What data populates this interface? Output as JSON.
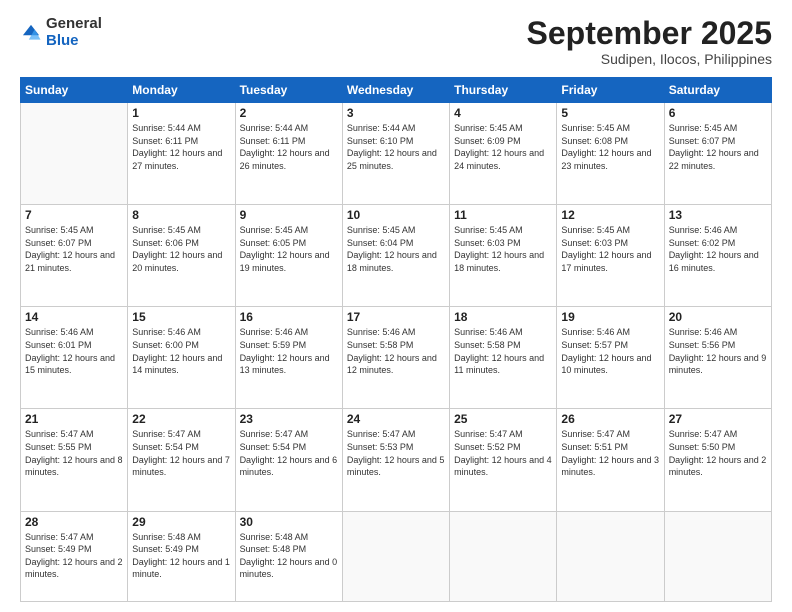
{
  "logo": {
    "general": "General",
    "blue": "Blue"
  },
  "header": {
    "month": "September 2025",
    "location": "Sudipen, Ilocos, Philippines"
  },
  "days": [
    "Sunday",
    "Monday",
    "Tuesday",
    "Wednesday",
    "Thursday",
    "Friday",
    "Saturday"
  ],
  "weeks": [
    [
      {
        "day": "",
        "sunrise": "",
        "sunset": "",
        "daylight": ""
      },
      {
        "day": "1",
        "sunrise": "Sunrise: 5:44 AM",
        "sunset": "Sunset: 6:11 PM",
        "daylight": "Daylight: 12 hours and 27 minutes."
      },
      {
        "day": "2",
        "sunrise": "Sunrise: 5:44 AM",
        "sunset": "Sunset: 6:11 PM",
        "daylight": "Daylight: 12 hours and 26 minutes."
      },
      {
        "day": "3",
        "sunrise": "Sunrise: 5:44 AM",
        "sunset": "Sunset: 6:10 PM",
        "daylight": "Daylight: 12 hours and 25 minutes."
      },
      {
        "day": "4",
        "sunrise": "Sunrise: 5:45 AM",
        "sunset": "Sunset: 6:09 PM",
        "daylight": "Daylight: 12 hours and 24 minutes."
      },
      {
        "day": "5",
        "sunrise": "Sunrise: 5:45 AM",
        "sunset": "Sunset: 6:08 PM",
        "daylight": "Daylight: 12 hours and 23 minutes."
      },
      {
        "day": "6",
        "sunrise": "Sunrise: 5:45 AM",
        "sunset": "Sunset: 6:07 PM",
        "daylight": "Daylight: 12 hours and 22 minutes."
      }
    ],
    [
      {
        "day": "7",
        "sunrise": "Sunrise: 5:45 AM",
        "sunset": "Sunset: 6:07 PM",
        "daylight": "Daylight: 12 hours and 21 minutes."
      },
      {
        "day": "8",
        "sunrise": "Sunrise: 5:45 AM",
        "sunset": "Sunset: 6:06 PM",
        "daylight": "Daylight: 12 hours and 20 minutes."
      },
      {
        "day": "9",
        "sunrise": "Sunrise: 5:45 AM",
        "sunset": "Sunset: 6:05 PM",
        "daylight": "Daylight: 12 hours and 19 minutes."
      },
      {
        "day": "10",
        "sunrise": "Sunrise: 5:45 AM",
        "sunset": "Sunset: 6:04 PM",
        "daylight": "Daylight: 12 hours and 18 minutes."
      },
      {
        "day": "11",
        "sunrise": "Sunrise: 5:45 AM",
        "sunset": "Sunset: 6:03 PM",
        "daylight": "Daylight: 12 hours and 18 minutes."
      },
      {
        "day": "12",
        "sunrise": "Sunrise: 5:45 AM",
        "sunset": "Sunset: 6:03 PM",
        "daylight": "Daylight: 12 hours and 17 minutes."
      },
      {
        "day": "13",
        "sunrise": "Sunrise: 5:46 AM",
        "sunset": "Sunset: 6:02 PM",
        "daylight": "Daylight: 12 hours and 16 minutes."
      }
    ],
    [
      {
        "day": "14",
        "sunrise": "Sunrise: 5:46 AM",
        "sunset": "Sunset: 6:01 PM",
        "daylight": "Daylight: 12 hours and 15 minutes."
      },
      {
        "day": "15",
        "sunrise": "Sunrise: 5:46 AM",
        "sunset": "Sunset: 6:00 PM",
        "daylight": "Daylight: 12 hours and 14 minutes."
      },
      {
        "day": "16",
        "sunrise": "Sunrise: 5:46 AM",
        "sunset": "Sunset: 5:59 PM",
        "daylight": "Daylight: 12 hours and 13 minutes."
      },
      {
        "day": "17",
        "sunrise": "Sunrise: 5:46 AM",
        "sunset": "Sunset: 5:58 PM",
        "daylight": "Daylight: 12 hours and 12 minutes."
      },
      {
        "day": "18",
        "sunrise": "Sunrise: 5:46 AM",
        "sunset": "Sunset: 5:58 PM",
        "daylight": "Daylight: 12 hours and 11 minutes."
      },
      {
        "day": "19",
        "sunrise": "Sunrise: 5:46 AM",
        "sunset": "Sunset: 5:57 PM",
        "daylight": "Daylight: 12 hours and 10 minutes."
      },
      {
        "day": "20",
        "sunrise": "Sunrise: 5:46 AM",
        "sunset": "Sunset: 5:56 PM",
        "daylight": "Daylight: 12 hours and 9 minutes."
      }
    ],
    [
      {
        "day": "21",
        "sunrise": "Sunrise: 5:47 AM",
        "sunset": "Sunset: 5:55 PM",
        "daylight": "Daylight: 12 hours and 8 minutes."
      },
      {
        "day": "22",
        "sunrise": "Sunrise: 5:47 AM",
        "sunset": "Sunset: 5:54 PM",
        "daylight": "Daylight: 12 hours and 7 minutes."
      },
      {
        "day": "23",
        "sunrise": "Sunrise: 5:47 AM",
        "sunset": "Sunset: 5:54 PM",
        "daylight": "Daylight: 12 hours and 6 minutes."
      },
      {
        "day": "24",
        "sunrise": "Sunrise: 5:47 AM",
        "sunset": "Sunset: 5:53 PM",
        "daylight": "Daylight: 12 hours and 5 minutes."
      },
      {
        "day": "25",
        "sunrise": "Sunrise: 5:47 AM",
        "sunset": "Sunset: 5:52 PM",
        "daylight": "Daylight: 12 hours and 4 minutes."
      },
      {
        "day": "26",
        "sunrise": "Sunrise: 5:47 AM",
        "sunset": "Sunset: 5:51 PM",
        "daylight": "Daylight: 12 hours and 3 minutes."
      },
      {
        "day": "27",
        "sunrise": "Sunrise: 5:47 AM",
        "sunset": "Sunset: 5:50 PM",
        "daylight": "Daylight: 12 hours and 2 minutes."
      }
    ],
    [
      {
        "day": "28",
        "sunrise": "Sunrise: 5:47 AM",
        "sunset": "Sunset: 5:49 PM",
        "daylight": "Daylight: 12 hours and 2 minutes."
      },
      {
        "day": "29",
        "sunrise": "Sunrise: 5:48 AM",
        "sunset": "Sunset: 5:49 PM",
        "daylight": "Daylight: 12 hours and 1 minute."
      },
      {
        "day": "30",
        "sunrise": "Sunrise: 5:48 AM",
        "sunset": "Sunset: 5:48 PM",
        "daylight": "Daylight: 12 hours and 0 minutes."
      },
      {
        "day": "",
        "sunrise": "",
        "sunset": "",
        "daylight": ""
      },
      {
        "day": "",
        "sunrise": "",
        "sunset": "",
        "daylight": ""
      },
      {
        "day": "",
        "sunrise": "",
        "sunset": "",
        "daylight": ""
      },
      {
        "day": "",
        "sunrise": "",
        "sunset": "",
        "daylight": ""
      }
    ]
  ]
}
